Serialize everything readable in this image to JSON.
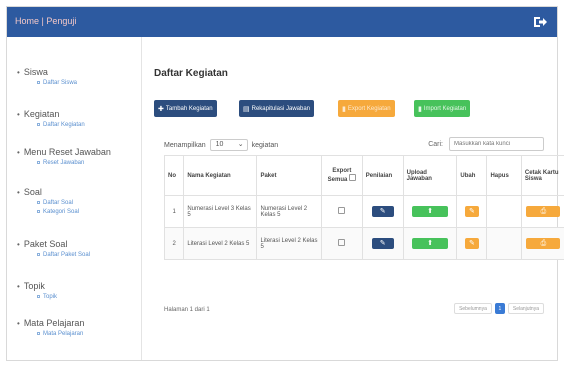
{
  "header": {
    "brand": "Home | Penguji",
    "logout_icon": "sign-out-icon",
    "bar_color": "#2d5aa0"
  },
  "sidebar": {
    "groups": [
      {
        "title": "Siswa",
        "subs": [
          "Daftar Siswa"
        ]
      },
      {
        "title": "Kegiatan",
        "subs": [
          "Daftar Kegiatan"
        ]
      },
      {
        "title": "Menu Reset Jawaban",
        "subs": [
          "Reset Jawaban"
        ]
      },
      {
        "title": "Soal",
        "subs": [
          "Daftar Soal",
          "Kategori Soal"
        ]
      },
      {
        "title": "Paket Soal",
        "subs": [
          "Daftar Paket Soal"
        ]
      },
      {
        "title": "Topik",
        "subs": [
          "Topik"
        ]
      },
      {
        "title": "Mata Pelajaran",
        "subs": [
          "Mata Pelajaran"
        ]
      }
    ]
  },
  "main": {
    "title": "Daftar Kegiatan",
    "buttons": {
      "add": "Tambah Kegiatan",
      "recap": "Rekapitulasi Jawaban",
      "export": "Export Kegiatan",
      "import": "Import Kegiatan"
    },
    "show_label": "Menampilkan",
    "show_value": "10",
    "show_suffix": "kegiatan",
    "search_label": "Cari:",
    "search_placeholder": "Masukkan kata kunci",
    "columns": {
      "no": "No",
      "nama": "Nama Kegiatan",
      "paket": "Paket",
      "export": "Export Semua",
      "penilaian": "Penilaian",
      "upload": "Upload Jawaban",
      "ubah": "Ubah",
      "hapus": "Hapus",
      "cetak": "Cetak Kartu Siswa"
    },
    "rows": [
      {
        "no": "1",
        "nama": "Numerasi Level 3 Kelas 5",
        "paket": "Numerasi Level 2 Kelas 5"
      },
      {
        "no": "2",
        "nama": "Literasi Level 2 Kelas 5",
        "paket": "Literasi Level 2 Kelas 5"
      }
    ],
    "page_info": "Halaman 1 dari 1",
    "pager": {
      "prev": "Sebelumnya",
      "current": "1",
      "next": "Selanjutnya"
    }
  }
}
